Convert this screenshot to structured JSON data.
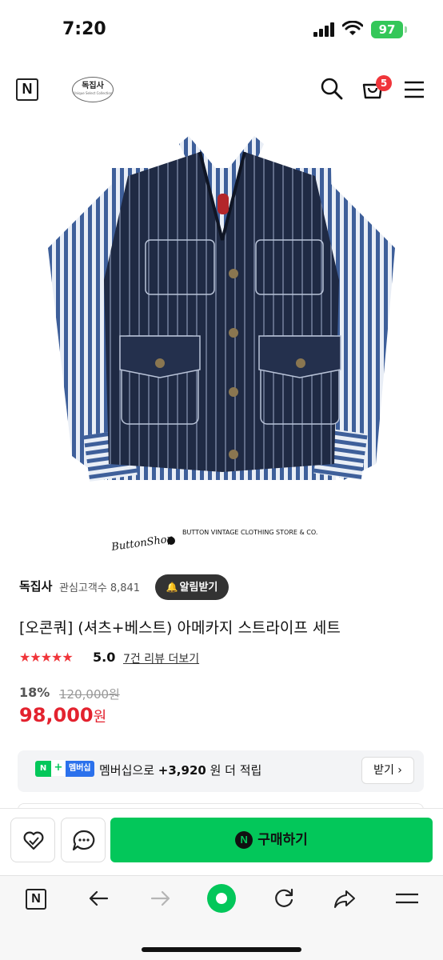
{
  "status_bar": {
    "time": "7:20",
    "battery": "97",
    "icons": [
      "cellular-signal-icon",
      "wifi-icon",
      "battery-charging-icon"
    ]
  },
  "header": {
    "naver_logo": "N",
    "store_logo_text": "독집사",
    "store_logo_subtext": "Unique Select Collection",
    "cart_count": "5",
    "icons": [
      "search-icon",
      "cart-icon",
      "menu-icon"
    ]
  },
  "product_image": {
    "caption_brand": "ButtonShop",
    "caption_title": "BUTTON VINTAGE CLOTHING STORE & CO."
  },
  "store": {
    "name": "독집사",
    "followers_label": "관심고객수",
    "followers_count": "8,841",
    "alarm_button": "알림받기"
  },
  "product": {
    "title": "[오콘쿼] (셔츠+베스트) 아메카지 스트라이프 세트",
    "rating_stars": "★★★★★",
    "rating_value": 5.0,
    "rating_text": "5.0",
    "review_link": "7건 리뷰 더보기",
    "discount": "18%",
    "original_price": "120,000원",
    "sale_price": "98,000",
    "currency": "원"
  },
  "membership": {
    "badge_n": "N",
    "badge_plus": "+",
    "badge_label": "멤버십",
    "text_prefix": "멤버십으로",
    "points": "+3,920",
    "text_suffix": "원 더 적립",
    "receive_button": "받기"
  },
  "purchase_bar": {
    "wishlist_icon": "heart-icon",
    "talk_icon": "chat-bubble-icon",
    "buy_button_icon": "N",
    "buy_button": "구매하기"
  },
  "browser_toolbar": {
    "home": "N",
    "icons": [
      "naver-home-icon",
      "back-arrow-icon",
      "forward-arrow-icon",
      "green-dot-icon",
      "refresh-icon",
      "share-icon",
      "menu-icon"
    ]
  },
  "colors": {
    "accent_green": "#03c75a",
    "price_red": "#e3222e",
    "badge_red": "#f0353a",
    "membership_blue": "#2b71ec"
  }
}
